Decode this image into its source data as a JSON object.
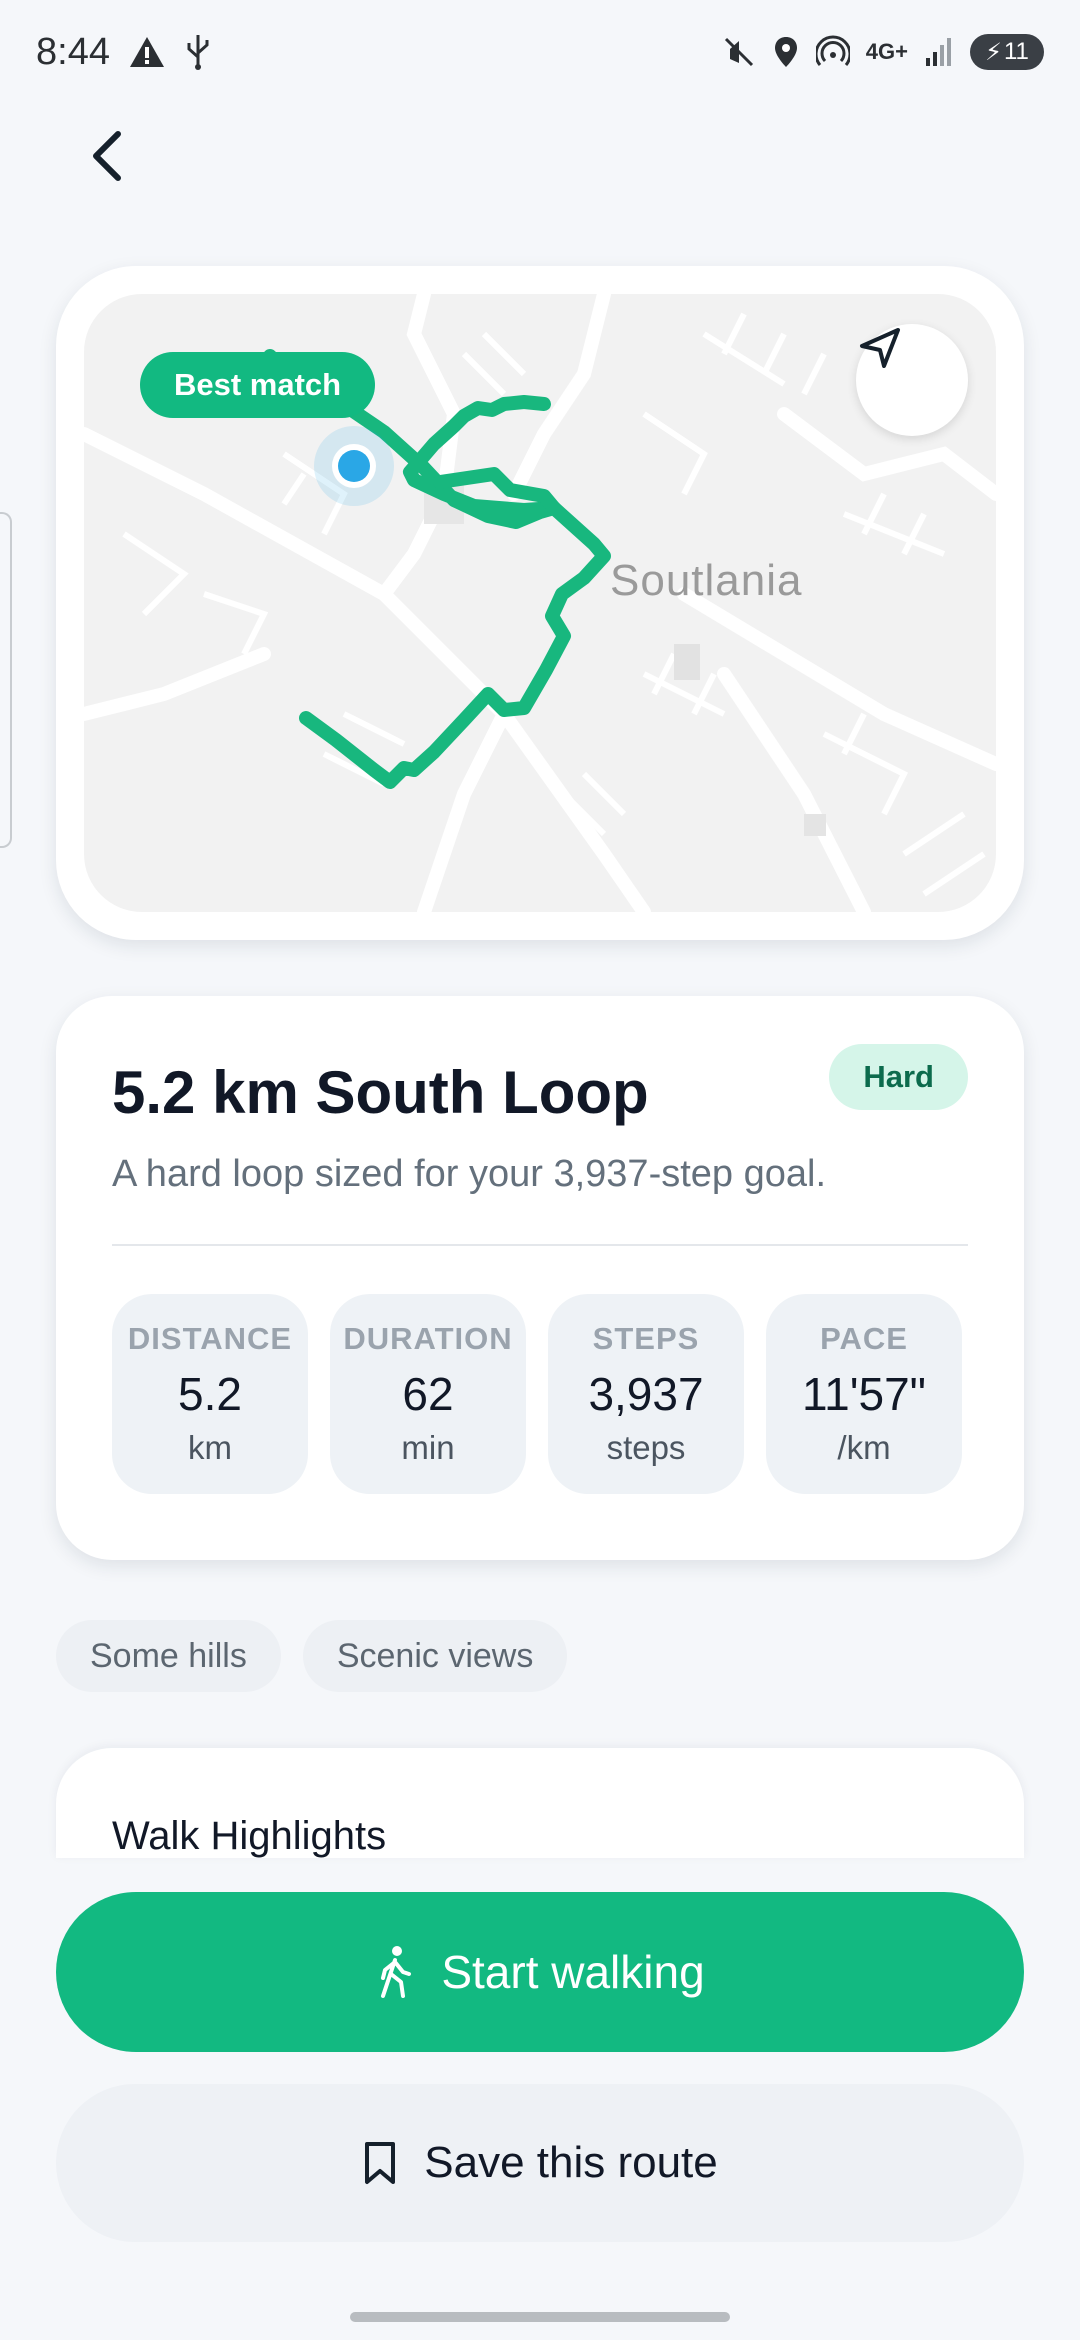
{
  "status_bar": {
    "time": "8:44",
    "network": "4G+",
    "battery": "11"
  },
  "map": {
    "badge": "Best match",
    "place_label": "Soutlania"
  },
  "route": {
    "title": "5.2 km South Loop",
    "difficulty": "Hard",
    "description": "A hard loop sized for your 3,937-step goal."
  },
  "stats": [
    {
      "label": "DISTANCE",
      "value": "5.2",
      "unit": "km"
    },
    {
      "label": "DURATION",
      "value": "62",
      "unit": "min"
    },
    {
      "label": "STEPS",
      "value": "3,937",
      "unit": "steps"
    },
    {
      "label": "PACE",
      "value": "11'57\"",
      "unit": "/km"
    }
  ],
  "tags": [
    "Some hills",
    "Scenic views"
  ],
  "highlights": {
    "title": "Walk Highlights"
  },
  "actions": {
    "start": "Start walking",
    "save": "Save this route"
  },
  "colors": {
    "accent": "#12b981",
    "route_line": "#18b77e",
    "location_dot": "#2aa7e6",
    "difficulty_bg": "#d5f5e9"
  },
  "icons": {
    "back": "chevron-left-icon",
    "locate": "navigation-arrow-icon",
    "walk": "walking-person-icon",
    "bookmark": "bookmark-icon"
  }
}
